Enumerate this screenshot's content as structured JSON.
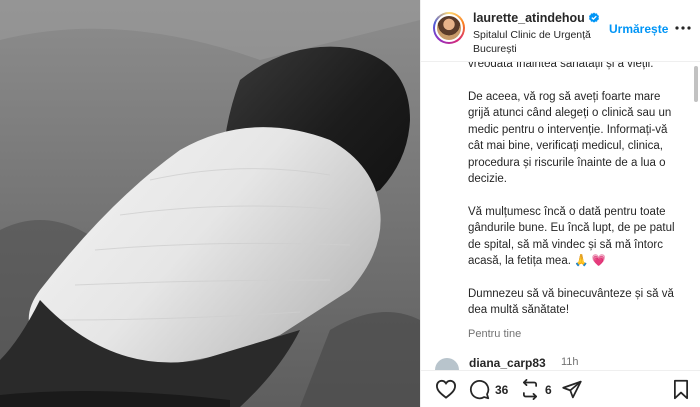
{
  "post": {
    "username": "laurette_atindehou",
    "location": "Spitalul Clinic de Urgență București",
    "follow_label": "Urmărește"
  },
  "caption": {
    "partial_line": "vreodată înaintea sănătății și a vieții.",
    "paragraphs": [
      "De aceea, vă rog să aveți foarte mare grijă atunci când alegeți o clinică sau un medic pentru o intervenție. Informați-vă cât mai bine, verificați medicul, clinica, procedura și riscurile înainte de a lua o decizie.",
      "Vă mulțumesc încă o dată pentru toate gândurile bune. Eu încă lupt, de pe patul de spital, să mă vindec și să mă întorc acasă, la fetița mea. 🙏 💗",
      "Dumnezeu să vă binecuvânteze și să vă dea multă sănătate!"
    ],
    "translate_label": "Pentru tine"
  },
  "comment": {
    "username": "diana_carp83",
    "time": "11h"
  },
  "actions": {
    "comments_count": "36",
    "reposts_count": "6"
  },
  "colors": {
    "accent": "#0095f6",
    "text": "#262626",
    "muted": "#737373"
  },
  "icons": [
    "verified-badge-icon",
    "more-options-icon",
    "heart-icon",
    "comment-icon",
    "repost-icon",
    "share-icon",
    "bookmark-icon"
  ]
}
